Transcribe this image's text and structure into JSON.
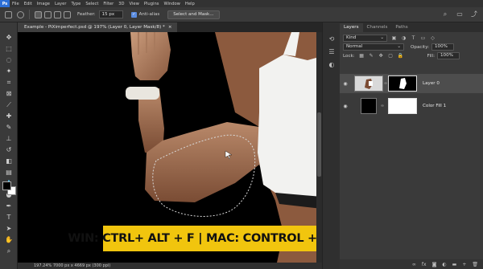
{
  "app": {
    "logo_text": "Ps",
    "menu": [
      "File",
      "Edit",
      "Image",
      "Layer",
      "Type",
      "Select",
      "Filter",
      "3D",
      "View",
      "Plugins",
      "Window",
      "Help"
    ]
  },
  "options": {
    "feather_label": "Feather:",
    "feather_value": "15 px",
    "antialias_label": "Anti-alias",
    "select_mask_label": "Select and Mask..."
  },
  "document": {
    "tab_title": "Example - PiXimperfect.psd @ 197% (Layer 0, Layer Mask/8) *",
    "close_glyph": "×",
    "status_text": "197.24%   7000 px x 4669 px (300 ppi)",
    "caption": "WIN: CTRL+ ALT + F  |  MAC: CONTROL + COMMAND + F"
  },
  "layers_panel": {
    "tabs": [
      "Layers",
      "Channels",
      "Paths"
    ],
    "kind_label": "Kind",
    "blend_mode": "Normal",
    "opacity_label": "Opacity:",
    "opacity_value": "100%",
    "lock_label": "Lock:",
    "fill_label": "Fill:",
    "fill_value": "100%",
    "layers": [
      {
        "name": "Layer 0"
      },
      {
        "name": "Color Fill 1"
      }
    ],
    "footer_icons": [
      "link-icon",
      "fx-icon",
      "mask-icon",
      "adjustment-icon",
      "folder-icon",
      "new-layer-icon",
      "trash-icon"
    ]
  },
  "colors": {
    "accent": "#f1c50e",
    "canvas_bg": "#000000",
    "panel_bg": "#3a3a3a"
  }
}
